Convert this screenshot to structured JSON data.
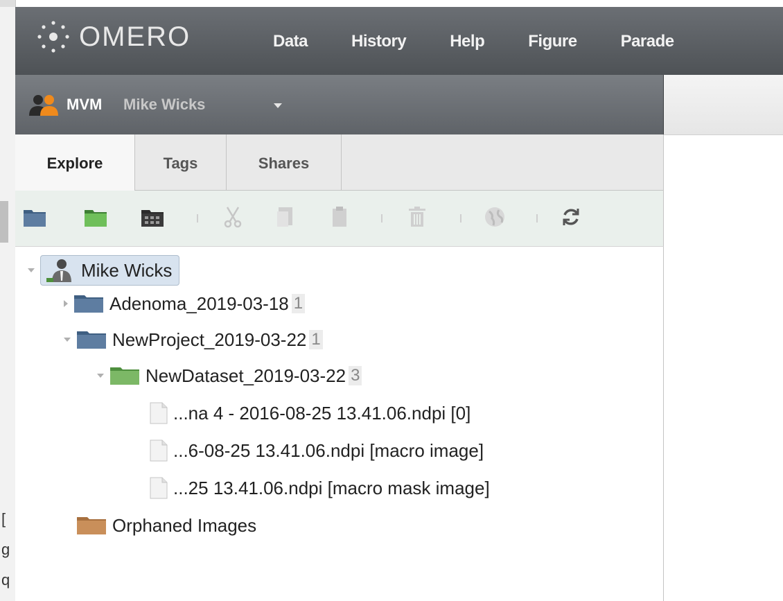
{
  "app": {
    "logo_text": "OMERO",
    "menu": [
      "Data",
      "History",
      "Help",
      "Figure",
      "Parade"
    ]
  },
  "user": {
    "group": "MVM",
    "name": "Mike Wicks"
  },
  "tabs": [
    {
      "label": "Explore",
      "active": true
    },
    {
      "label": "Tags",
      "active": false
    },
    {
      "label": "Shares",
      "active": false
    }
  ],
  "toolbar": {
    "icons": [
      "new-project-icon",
      "new-dataset-icon",
      "new-screen-icon",
      "cut-icon",
      "copy-icon",
      "paste-icon",
      "delete-icon",
      "globe-icon",
      "refresh-icon"
    ]
  },
  "tree": {
    "root": {
      "label": "Mike Wicks"
    },
    "projects": [
      {
        "label": "Adenoma_2019-03-18",
        "count": "1"
      },
      {
        "label": "NewProject_2019-03-22",
        "count": "1"
      }
    ],
    "dataset": {
      "label": "NewDataset_2019-03-22",
      "count": "3"
    },
    "images": [
      "...na 4 - 2016-08-25 13.41.06.ndpi [0]",
      "...6-08-25 13.41.06.ndpi [macro image]",
      "...25 13.41.06.ndpi [macro mask image]"
    ],
    "orphaned": "Orphaned Images"
  },
  "colors": {
    "project_folder": "#5e7da1",
    "dataset_folder": "#7cb866",
    "orphan_folder": "#c98f5a",
    "topbar": "#5a5e62"
  }
}
